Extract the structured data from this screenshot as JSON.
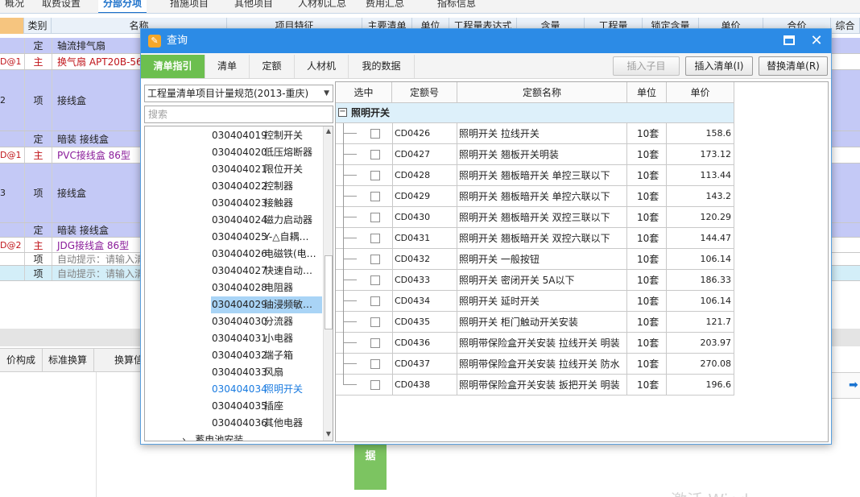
{
  "top_tabs": [
    {
      "label": "概况"
    },
    {
      "label": "取费设置"
    },
    {
      "label": "分部分项"
    },
    {
      "label": "措施项目"
    },
    {
      "label": "其他项目"
    },
    {
      "label": "人材机汇总"
    },
    {
      "label": "费用汇总"
    },
    {
      "label": "指标信息"
    }
  ],
  "bg_table": {
    "headers": [
      "",
      "类别",
      "名称",
      "项目特征",
      "主要清单",
      "单位",
      "工程量表达式",
      "含量",
      "工程量",
      "锁定含量",
      "单价",
      "合价",
      "综合"
    ],
    "rows": [
      {
        "c0": "",
        "c1": "定",
        "c2": "轴流排气扇"
      },
      {
        "c0": "D@1",
        "c1": "主",
        "c2": "换气扇  APT20B-56…"
      },
      {
        "c0": "2",
        "c1": "项",
        "c2": "接线盒"
      },
      {
        "c0": "",
        "c1": "定",
        "c2": "暗装 接线盒"
      },
      {
        "c0": "D@1",
        "c1": "主",
        "c2": "PVC接线盒 86型"
      },
      {
        "c0": "3",
        "c1": "项",
        "c2": "接线盒"
      },
      {
        "c0": "",
        "c1": "定",
        "c2": "暗装 接线盒"
      },
      {
        "c0": "D@2",
        "c1": "主",
        "c2": "JDG接线盒 86型"
      },
      {
        "c0": "",
        "c1": "项",
        "c2": "自动提示：请输入清…"
      },
      {
        "c0": "",
        "c1": "项",
        "c2": "自动提示：请输入清…"
      }
    ]
  },
  "bottom_tabs": [
    {
      "label": "价构成"
    },
    {
      "label": "标准换算"
    },
    {
      "label": "换算信…"
    }
  ],
  "side_button": {
    "label": "据"
  },
  "watermark": "激活 Wind…",
  "dialog": {
    "title": "查询",
    "tabs": [
      {
        "label": "清单指引"
      },
      {
        "label": "清单"
      },
      {
        "label": "定额"
      },
      {
        "label": "人材机"
      },
      {
        "label": "我的数据"
      }
    ],
    "buttons": {
      "insert_child": "插入子目",
      "insert_list": "插入清单(I)",
      "replace_list": "替换清单(R)"
    },
    "library_select": "工程量清单项目计量规范(2013-重庆)",
    "search_placeholder": "搜索",
    "tree": [
      {
        "code": "030404019",
        "name": "控制开关"
      },
      {
        "code": "030404020",
        "name": "低压熔断器"
      },
      {
        "code": "030404021",
        "name": "限位开关"
      },
      {
        "code": "030404022",
        "name": "控制器"
      },
      {
        "code": "030404023",
        "name": "接触器"
      },
      {
        "code": "030404024",
        "name": "磁力启动器"
      },
      {
        "code": "030404025",
        "name": "Y-△自耦…"
      },
      {
        "code": "030404026",
        "name": "电磁铁(电…"
      },
      {
        "code": "030404027",
        "name": "快速自动…"
      },
      {
        "code": "030404028",
        "name": "电阻器"
      },
      {
        "code": "030404029",
        "name": "油浸频敏…"
      },
      {
        "code": "030404030",
        "name": "分流器"
      },
      {
        "code": "030404031",
        "name": "小电器"
      },
      {
        "code": "030404032",
        "name": "端子箱"
      },
      {
        "code": "030404033",
        "name": "风扇"
      },
      {
        "code": "030404034",
        "name": "照明开关"
      },
      {
        "code": "030404035",
        "name": "插座"
      },
      {
        "code": "030404036",
        "name": "其他电器"
      }
    ],
    "tree_parent_next": "蓄电池安装",
    "quota_table": {
      "headers": [
        "选中",
        "定额号",
        "定额名称",
        "单位",
        "单价"
      ],
      "group_label": "照明开关",
      "rows": [
        {
          "code": "CD0426",
          "name": "照明开关 拉线开关",
          "unit": "10套",
          "price": "158.6"
        },
        {
          "code": "CD0427",
          "name": "照明开关 翘板开关明装",
          "unit": "10套",
          "price": "173.12"
        },
        {
          "code": "CD0428",
          "name": "照明开关 翘板暗开关 单控三联以下",
          "unit": "10套",
          "price": "113.44"
        },
        {
          "code": "CD0429",
          "name": "照明开关 翘板暗开关 单控六联以下",
          "unit": "10套",
          "price": "143.2"
        },
        {
          "code": "CD0430",
          "name": "照明开关 翘板暗开关 双控三联以下",
          "unit": "10套",
          "price": "120.29"
        },
        {
          "code": "CD0431",
          "name": "照明开关 翘板暗开关 双控六联以下",
          "unit": "10套",
          "price": "144.47"
        },
        {
          "code": "CD0432",
          "name": "照明开关 一般按钮",
          "unit": "10套",
          "price": "106.14"
        },
        {
          "code": "CD0433",
          "name": "照明开关 密闭开关 5A以下",
          "unit": "10套",
          "price": "186.33"
        },
        {
          "code": "CD0434",
          "name": "照明开关 延时开关",
          "unit": "10套",
          "price": "106.14"
        },
        {
          "code": "CD0435",
          "name": "照明开关 柜门触动开关安装",
          "unit": "10套",
          "price": "121.7"
        },
        {
          "code": "CD0436",
          "name": "照明带保险盒开关安装 拉线开关 明装",
          "unit": "10套",
          "price": "203.97"
        },
        {
          "code": "CD0437",
          "name": "照明带保险盒开关安装 拉线开关 防水",
          "unit": "10套",
          "price": "270.08"
        },
        {
          "code": "CD0438",
          "name": "照明带保险盒开关安装 扳把开关 明装",
          "unit": "10套",
          "price": "196.6"
        }
      ]
    }
  },
  "colors": {
    "title_bar": "#2c8be6",
    "active_tab": "#6cbf4f",
    "selected_tree": "#a9d4f6",
    "row_purple": "#c4c9f6",
    "row_cyan": "#d3eef8"
  }
}
